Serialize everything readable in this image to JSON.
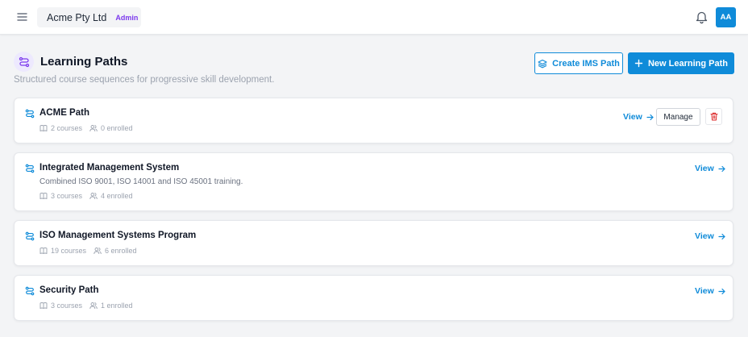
{
  "topbar": {
    "org_name": "Acme Pty Ltd",
    "role_badge": "Admin",
    "avatar_initials": "AA"
  },
  "header": {
    "title": "Learning Paths",
    "subtitle": "Structured course sequences for progressive skill development.",
    "create_ims_label": "Create IMS Path",
    "new_path_label": "New Learning Path"
  },
  "paths": [
    {
      "title": "ACME Path",
      "description": "",
      "courses": "2 courses",
      "enrolled": "0 enrolled",
      "view_label": "View",
      "manage_label": "Manage"
    },
    {
      "title": "Integrated Management System",
      "description": "Combined ISO 9001, ISO 14001 and ISO 45001 training.",
      "courses": "3 courses",
      "enrolled": "4 enrolled",
      "view_label": "View"
    },
    {
      "title": "ISO Management Systems Program",
      "description": "",
      "courses": "19 courses",
      "enrolled": "6 enrolled",
      "view_label": "View"
    },
    {
      "title": "Security Path",
      "description": "",
      "courses": "3 courses",
      "enrolled": "1 enrolled",
      "view_label": "View"
    }
  ],
  "colors": {
    "accent": "#0f8bd9",
    "badge_purple": "#7c3aed",
    "danger": "#dc2626"
  },
  "icons": {
    "menu": "hamburger-icon",
    "notifications": "bell-icon",
    "page": "route-icon",
    "ims": "layers-icon",
    "new": "plus-icon",
    "courses": "book-icon",
    "enrolled": "users-icon",
    "view": "arrow-right-icon",
    "delete": "trash-icon"
  }
}
